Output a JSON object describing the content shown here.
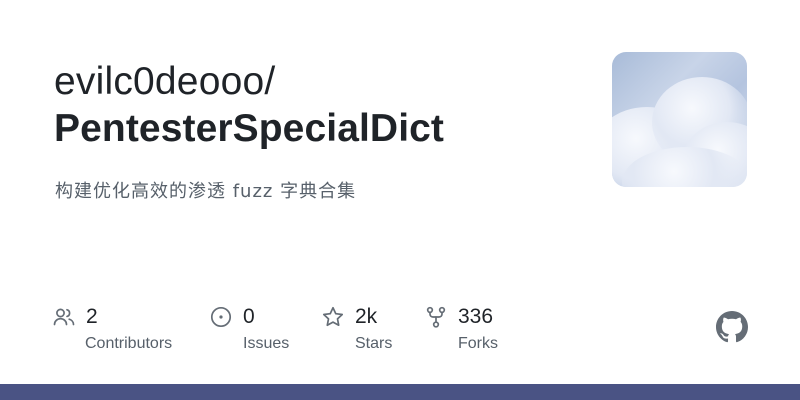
{
  "repo": {
    "owner": "evilc0deooo/",
    "name": "PentesterSpecialDict",
    "description": "构建优化高效的渗透 fuzz 字典合集"
  },
  "stats": {
    "contributors": {
      "value": "2",
      "label": "Contributors",
      "icon": "people-icon"
    },
    "issues": {
      "value": "0",
      "label": "Issues",
      "icon": "issue-opened-icon"
    },
    "stars": {
      "value": "2k",
      "label": "Stars",
      "icon": "star-icon"
    },
    "forks": {
      "value": "336",
      "label": "Forks",
      "icon": "repo-forked-icon"
    }
  },
  "colors": {
    "accent_bar": "#4a5384",
    "icon": "#656d76",
    "text_primary": "#1f2328",
    "text_secondary": "#57606a"
  },
  "icons": {
    "brand": "github-mark-icon",
    "avatar": "cloud-sky-avatar"
  }
}
